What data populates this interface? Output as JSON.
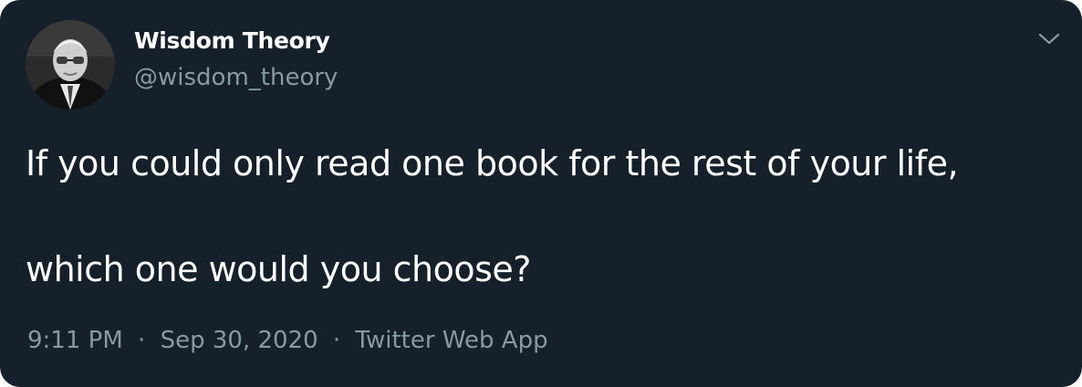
{
  "tweet": {
    "author": {
      "display_name": "Wisdom Theory",
      "handle": "@wisdom_theory",
      "avatar_icon": "profile-photo"
    },
    "menu_icon": "chevron-down-icon",
    "text_lines": [
      "If you could only read one book for the rest of your life,",
      "",
      "which one would you choose?"
    ],
    "meta": {
      "time": "9:11 PM",
      "separator": "·",
      "date": "Sep 30, 2020",
      "source": "Twitter Web App"
    }
  },
  "colors": {
    "background": "#15202b",
    "primary_text": "#ffffff",
    "secondary_text": "#8899a6"
  }
}
